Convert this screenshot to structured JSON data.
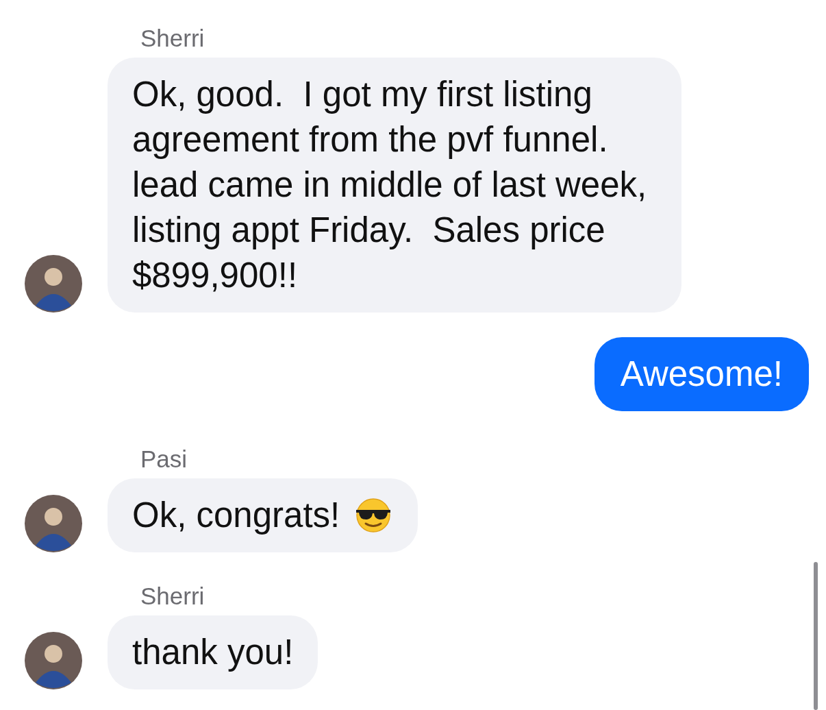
{
  "messages": [
    {
      "kind": "received",
      "sender": "Sherri",
      "text": "Ok, good.  I got my first listing agreement from the pvf funnel.  lead came in middle of last week, listing appt Friday.  Sales price $899,900!!"
    },
    {
      "kind": "sent",
      "text": "Awesome!"
    },
    {
      "kind": "received_sunglasses",
      "sender": "Pasi",
      "text": "Ok, congrats!"
    },
    {
      "kind": "received",
      "sender": "Sherri",
      "text": "thank you!"
    }
  ]
}
